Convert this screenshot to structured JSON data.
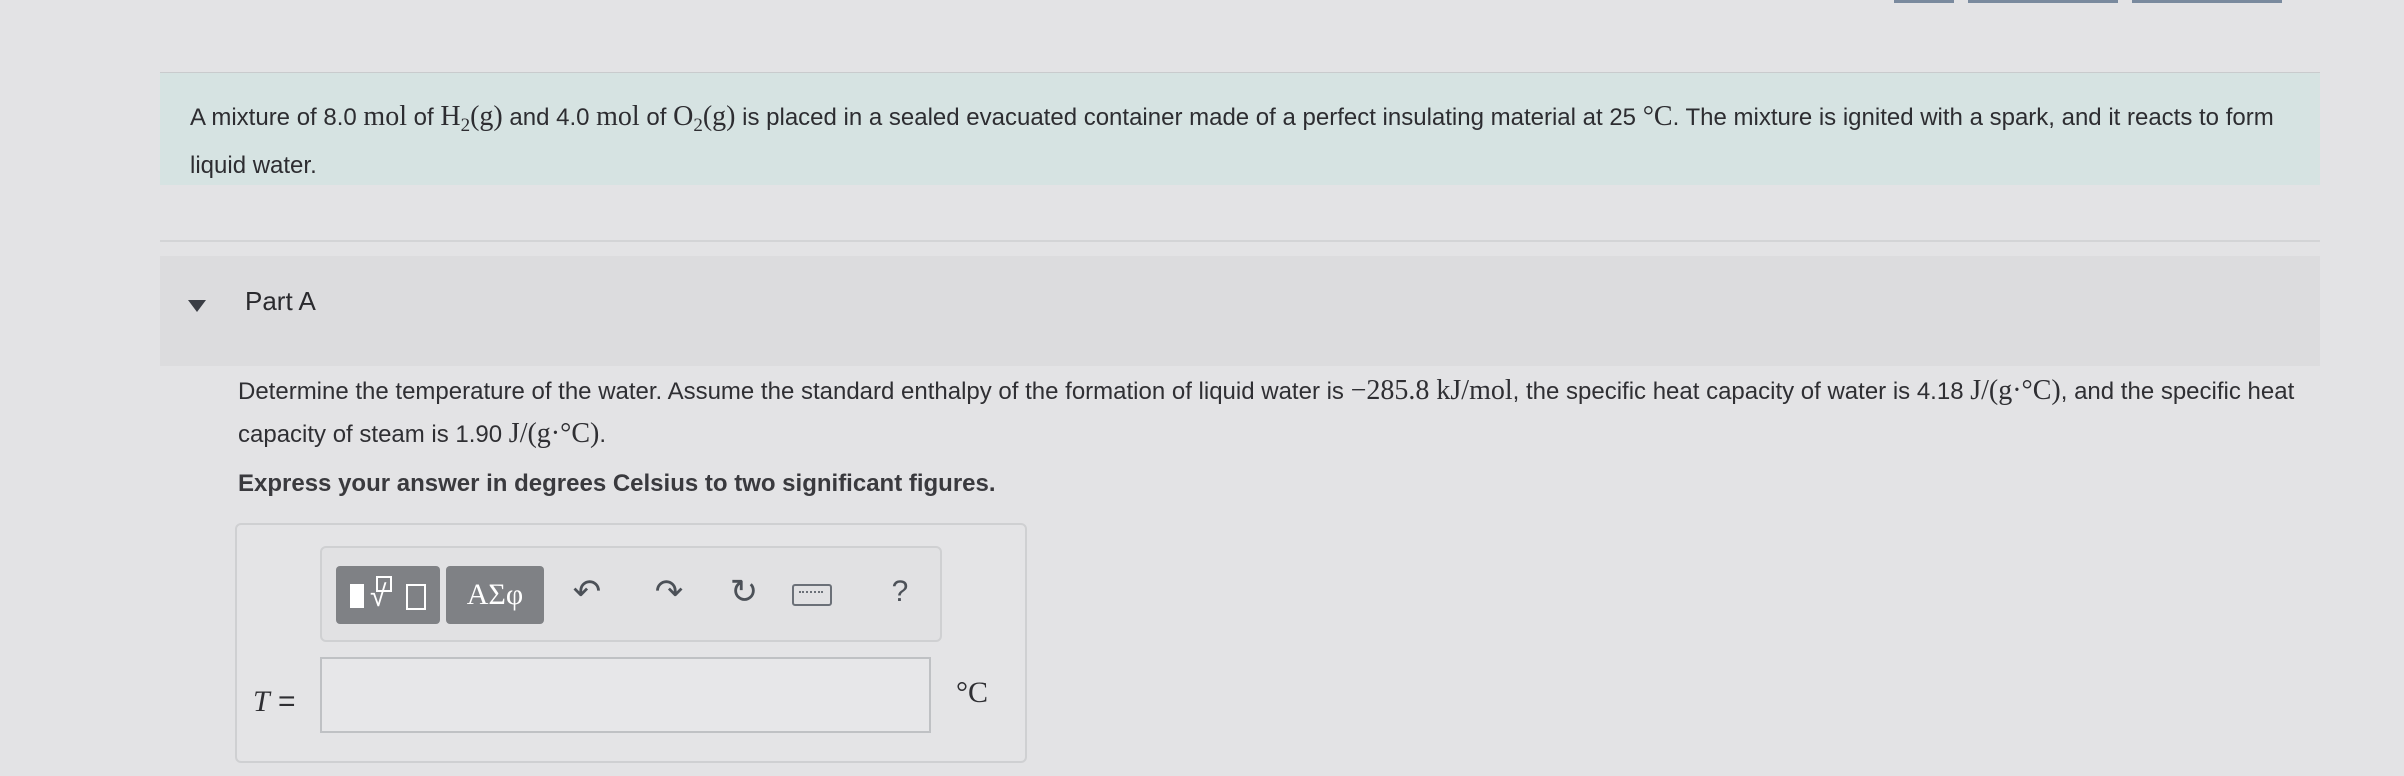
{
  "intro": {
    "t1": "A mixture of 8.0 ",
    "m1": "mol",
    "t2": " of ",
    "m2": "H",
    "s2": "2",
    "m3": "(g)",
    "t3": " and 4.0 ",
    "m4": "mol",
    "t4": " of ",
    "m5": "O",
    "s5": "2",
    "m6": "(g)",
    "t5": " is placed in a sealed evacuated container made of a perfect insulating material at 25 ",
    "m7": "°C",
    "t6": ". The mixture is ignited with a spark, and it reacts to form liquid water."
  },
  "part": {
    "title": "Part A"
  },
  "question": {
    "t1": "Determine the temperature of the water. Assume the standard enthalpy of the formation of liquid water is ",
    "m1": "−285.8 kJ/mol",
    "t2": ", the specific heat capacity of water is 4.18 ",
    "m2": "J/(g·°C)",
    "t3": ", and the specific heat capacity of steam is 1.90 ",
    "m3": "J/(g·°C)",
    "t4": "."
  },
  "instruction": "Express your answer in degrees Celsius to two significant figures.",
  "toolbar": {
    "greek_label": "ΑΣφ",
    "help_label": "?",
    "icons": [
      "templates-icon",
      "greek-symbols-icon",
      "undo-icon",
      "redo-icon",
      "reset-icon",
      "keyboard-icon",
      "help-icon"
    ]
  },
  "answer": {
    "variable": "T",
    "equals": " = ",
    "value": "",
    "unit": "°C"
  }
}
